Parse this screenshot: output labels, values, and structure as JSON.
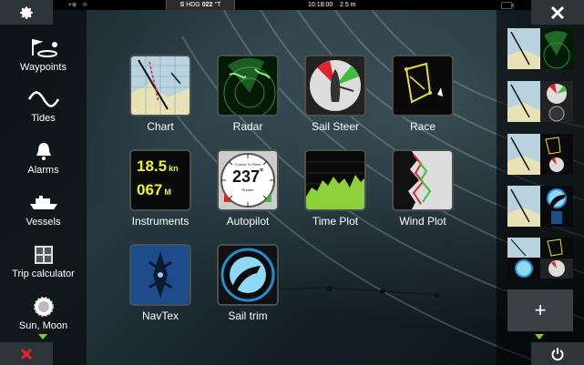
{
  "status_bar": {
    "heading_prefix": "S",
    "heading_label": "HDG",
    "heading_value": "022",
    "heading_unit": "°T",
    "time": "10:18:00",
    "depth": "2.5 m"
  },
  "sidebar": {
    "items": [
      {
        "label": "Waypoints",
        "icon": "waypoints-icon"
      },
      {
        "label": "Tides",
        "icon": "tides-icon"
      },
      {
        "label": "Alarms",
        "icon": "alarm-bell-icon"
      },
      {
        "label": "Vessels",
        "icon": "vessel-icon"
      },
      {
        "label": "Trip calculator",
        "icon": "trip-calculator-icon"
      },
      {
        "label": "Sun, Moon",
        "icon": "sun-moon-icon"
      }
    ]
  },
  "apps": [
    {
      "label": "Chart"
    },
    {
      "label": "Radar"
    },
    {
      "label": "Sail Steer"
    },
    {
      "label": "Race"
    },
    {
      "label": "Instruments",
      "speed_value": "18.5",
      "speed_unit": "kn",
      "depth_value": "067",
      "depth_unit": "M"
    },
    {
      "label": "Autopilot",
      "dial_caption": "Course To Steer",
      "dial_value": "237",
      "dial_unit": "°",
      "dial_sub": "Rudder"
    },
    {
      "label": "Time Plot"
    },
    {
      "label": "Wind Plot"
    },
    {
      "label": "NavTex"
    },
    {
      "label": "Sail trim"
    }
  ],
  "right_panel": {
    "add_label": "+"
  },
  "colors": {
    "accent_green": "#7bd12b",
    "alert_red": "#e0252a",
    "instrument_yellow": "#e8f23a"
  }
}
